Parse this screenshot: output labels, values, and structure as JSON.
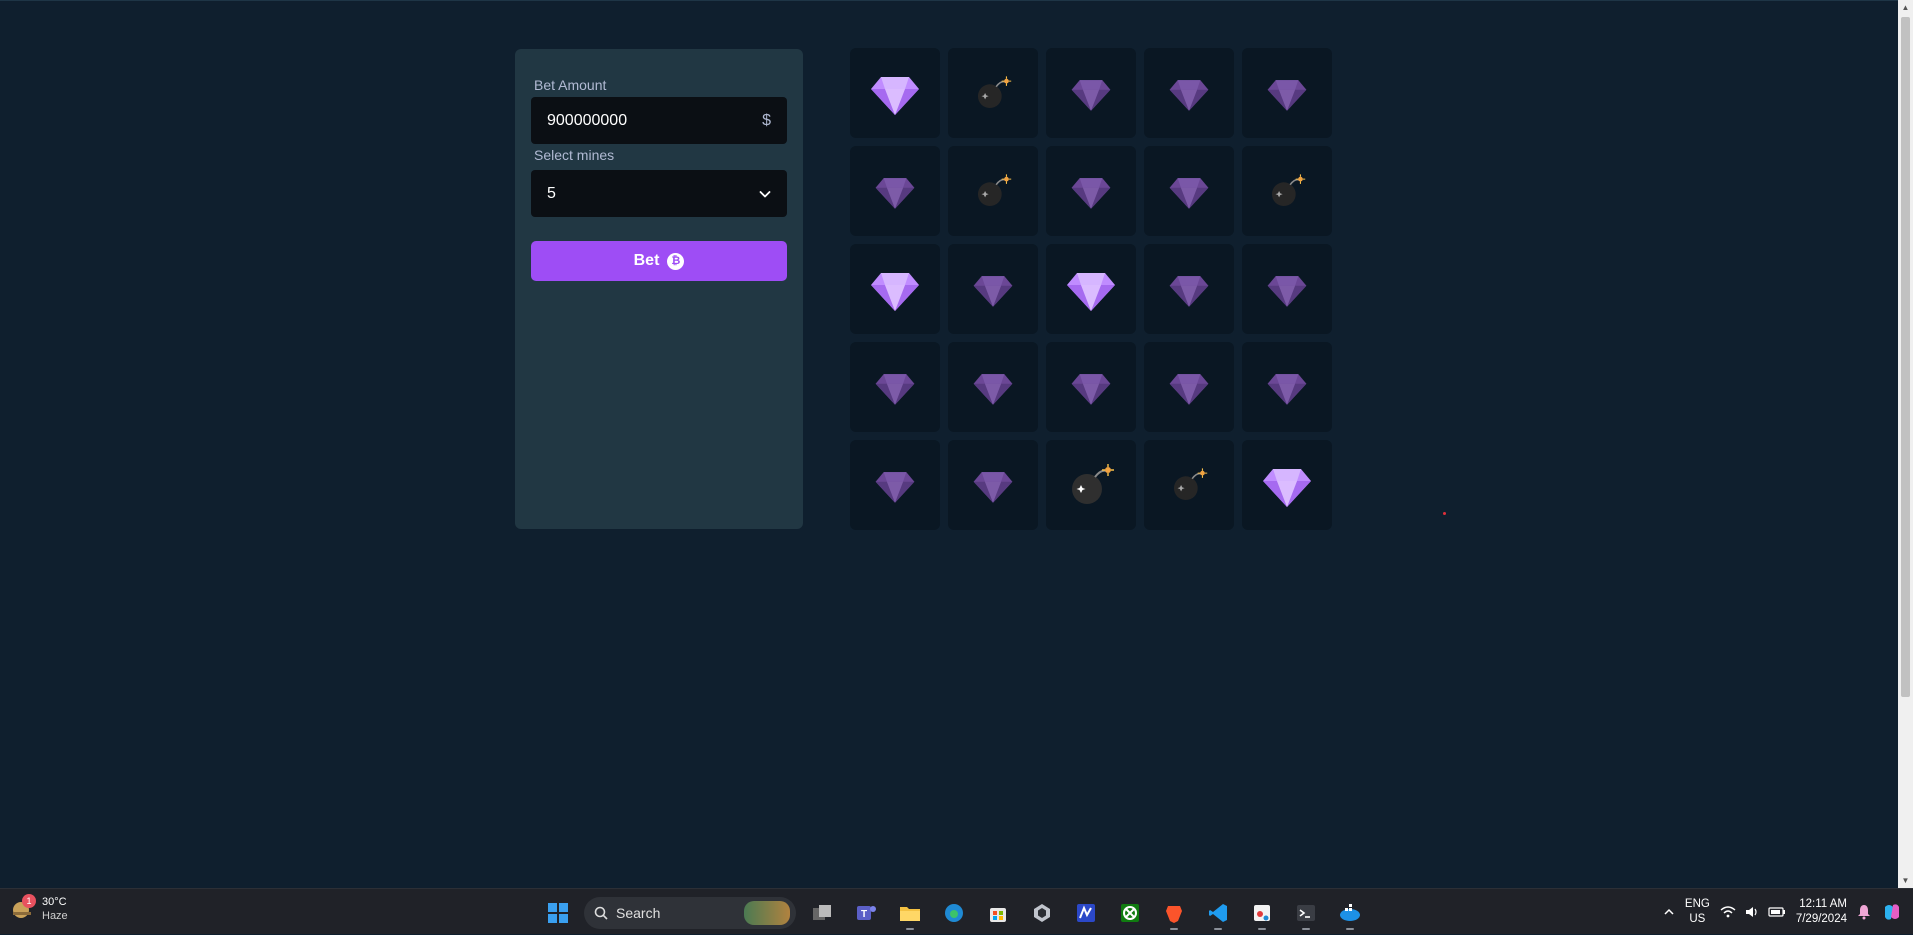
{
  "bet_panel": {
    "amount_label": "Bet Amount",
    "amount_value": "900000000",
    "currency_symbol": "$",
    "mines_label": "Select mines",
    "mines_value": "5",
    "bet_button": "Bet",
    "coin_glyph": "₿"
  },
  "grid": {
    "rows": 5,
    "cols": 5,
    "tiles": [
      [
        "gem-revealed",
        "bomb",
        "gem",
        "gem",
        "gem"
      ],
      [
        "gem",
        "bomb",
        "gem",
        "gem",
        "bomb"
      ],
      [
        "gem-revealed",
        "gem",
        "gem-revealed",
        "gem",
        "gem"
      ],
      [
        "gem",
        "gem",
        "gem",
        "gem",
        "gem"
      ],
      [
        "gem",
        "gem",
        "bomb-revealed",
        "bomb",
        "gem-revealed"
      ]
    ]
  },
  "taskbar": {
    "weather_temp": "30°C",
    "weather_cond": "Haze",
    "weather_badge": "1",
    "search_label": "Search",
    "lang_top": "ENG",
    "lang_bottom": "US",
    "time": "12:11 AM",
    "date": "7/29/2024",
    "apps": [
      "windows-start-icon",
      "search",
      "task-view-icon",
      "teams-icon",
      "file-explorer-icon",
      "edge-icon",
      "store-icon",
      "app-cube-icon",
      "app-m-icon",
      "xbox-icon",
      "brave-icon",
      "vscode-icon",
      "snipping-icon",
      "terminal-icon",
      "docker-icon"
    ]
  },
  "colors": {
    "background": "#0f1f2e",
    "panel": "#213743",
    "tile": "#0a1723",
    "accent": "#9e4df5"
  }
}
